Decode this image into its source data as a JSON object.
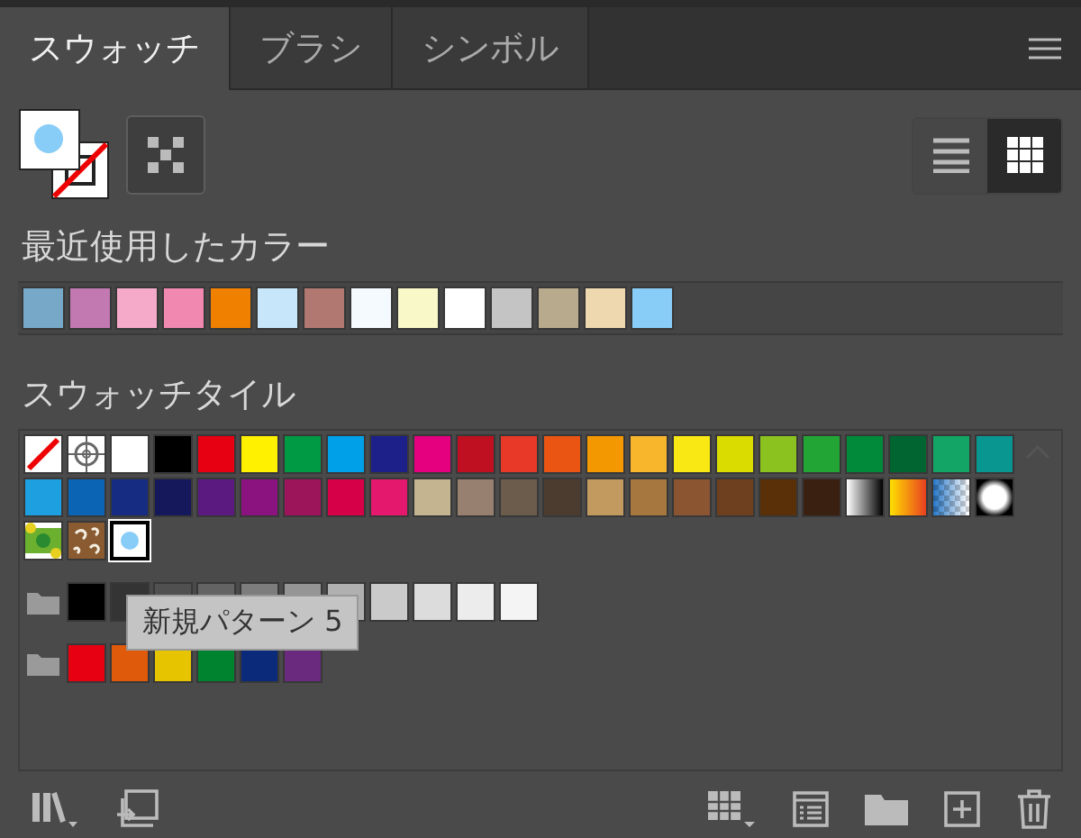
{
  "tabs": [
    {
      "label": "スウォッチ",
      "selected": true
    },
    {
      "label": "ブラシ",
      "selected": false
    },
    {
      "label": "シンボル",
      "selected": false
    }
  ],
  "view_buttons": [
    {
      "kind": "list",
      "selected": false
    },
    {
      "kind": "grid",
      "selected": true
    }
  ],
  "recent": {
    "title": "最近使用したカラー",
    "colors": [
      {
        "color": "#77a8c8"
      },
      {
        "color": "#c278b0"
      },
      {
        "color": "#f4aac8"
      },
      {
        "color": "#f088b0"
      },
      {
        "color": "#f08000"
      },
      {
        "color": "#c8e6fa"
      },
      {
        "color": "#b07870"
      },
      {
        "color": "#f4faff"
      },
      {
        "color": "#f8f8c8"
      },
      {
        "color": "#ffffff"
      },
      {
        "color": "#c4c4c4"
      },
      {
        "color": "#b8aa8c"
      },
      {
        "color": "#eed8b0"
      },
      {
        "color": "#88ccf8"
      }
    ]
  },
  "tiles": {
    "title": "スウォッチタイル",
    "groups": [
      {
        "swatches": [
          {
            "kind": "none",
            "selected": false
          },
          {
            "kind": "registration",
            "selected": false
          },
          {
            "kind": "color",
            "color": "#ffffff",
            "selected": false
          },
          {
            "kind": "color",
            "color": "#000000",
            "selected": false
          },
          {
            "kind": "color",
            "color": "#e60012",
            "selected": false
          },
          {
            "kind": "color",
            "color": "#fff100",
            "selected": false
          },
          {
            "kind": "color",
            "color": "#009944",
            "selected": false
          },
          {
            "kind": "color",
            "color": "#00a0e9",
            "selected": false
          },
          {
            "kind": "color",
            "color": "#1d2088",
            "selected": false
          },
          {
            "kind": "color",
            "color": "#e4007f",
            "selected": false
          },
          {
            "kind": "color",
            "color": "#be1020",
            "selected": false
          },
          {
            "kind": "color",
            "color": "#e83828",
            "selected": false
          },
          {
            "kind": "color",
            "color": "#ea5514",
            "selected": false
          },
          {
            "kind": "color",
            "color": "#f39800",
            "selected": false
          },
          {
            "kind": "color",
            "color": "#f8b62d",
            "selected": false
          },
          {
            "kind": "color",
            "color": "#f9e814",
            "selected": false
          },
          {
            "kind": "color",
            "color": "#dadc00",
            "selected": false
          },
          {
            "kind": "color",
            "color": "#8bc220",
            "selected": false
          },
          {
            "kind": "color",
            "color": "#22a535",
            "selected": false
          },
          {
            "kind": "color",
            "color": "#008a3a",
            "selected": false
          },
          {
            "kind": "color",
            "color": "#006531",
            "selected": false
          },
          {
            "kind": "color",
            "color": "#13a565",
            "selected": false
          },
          {
            "kind": "color",
            "color": "#0a9690",
            "selected": false
          },
          {
            "kind": "color",
            "color": "#1ea0e0",
            "selected": false
          },
          {
            "kind": "color",
            "color": "#0b64b4",
            "selected": false
          },
          {
            "kind": "color",
            "color": "#162c83",
            "selected": false
          },
          {
            "kind": "color",
            "color": "#15185a",
            "selected": false
          },
          {
            "kind": "color",
            "color": "#5a1a80",
            "selected": false
          },
          {
            "kind": "color",
            "color": "#8a137f",
            "selected": false
          },
          {
            "kind": "color",
            "color": "#9c145a",
            "selected": false
          },
          {
            "kind": "color",
            "color": "#d60048",
            "selected": false
          },
          {
            "kind": "color",
            "color": "#e4196e",
            "selected": false
          },
          {
            "kind": "color",
            "color": "#c4b490",
            "selected": false
          },
          {
            "kind": "color",
            "color": "#988070",
            "selected": false
          },
          {
            "kind": "color",
            "color": "#6c5c4c",
            "selected": false
          },
          {
            "kind": "color",
            "color": "#4c3c30",
            "selected": false
          },
          {
            "kind": "color",
            "color": "#c29a60",
            "selected": false
          },
          {
            "kind": "color",
            "color": "#a67840",
            "selected": false
          },
          {
            "kind": "color",
            "color": "#8a5530",
            "selected": false
          },
          {
            "kind": "color",
            "color": "#6e4020",
            "selected": false
          },
          {
            "kind": "color",
            "color": "#5a3008",
            "selected": false
          },
          {
            "kind": "color",
            "color": "#3a2010",
            "selected": false
          },
          {
            "kind": "grayramp",
            "selected": false
          },
          {
            "kind": "warmramp",
            "selected": false
          },
          {
            "kind": "fade",
            "selected": false
          },
          {
            "kind": "radial",
            "selected": false
          },
          {
            "kind": "foliage",
            "selected": false
          },
          {
            "kind": "swirl",
            "selected": false
          },
          {
            "kind": "dot",
            "selected": true
          }
        ]
      },
      {
        "folder": true,
        "swatches": [
          {
            "kind": "color",
            "color": "#000000",
            "selected": false
          },
          {
            "kind": "color",
            "color": "#343434",
            "selected": false
          },
          {
            "kind": "color",
            "color": "#505050",
            "selected": false
          },
          {
            "kind": "color",
            "color": "#636363",
            "selected": false
          },
          {
            "kind": "color",
            "color": "#7d7d7d",
            "selected": false
          },
          {
            "kind": "color",
            "color": "#959595",
            "selected": false
          },
          {
            "kind": "color",
            "color": "#b0b0b0",
            "selected": false
          },
          {
            "kind": "color",
            "color": "#cacaca",
            "selected": false
          },
          {
            "kind": "color",
            "color": "#dcdcdc",
            "selected": false
          },
          {
            "kind": "color",
            "color": "#ececec",
            "selected": false
          },
          {
            "kind": "color",
            "color": "#f4f4f4",
            "selected": false
          }
        ]
      },
      {
        "folder": true,
        "swatches": [
          {
            "kind": "color",
            "color": "#e60012",
            "selected": false
          },
          {
            "kind": "color",
            "color": "#e05a0c",
            "selected": false
          },
          {
            "kind": "color",
            "color": "#e6c400",
            "selected": false
          },
          {
            "kind": "color",
            "color": "#00832f",
            "selected": false
          },
          {
            "kind": "color",
            "color": "#0c2a7a",
            "selected": false
          },
          {
            "kind": "color",
            "color": "#6a2a7e",
            "selected": false
          }
        ]
      }
    ]
  },
  "tooltip": "新規パターン 5"
}
